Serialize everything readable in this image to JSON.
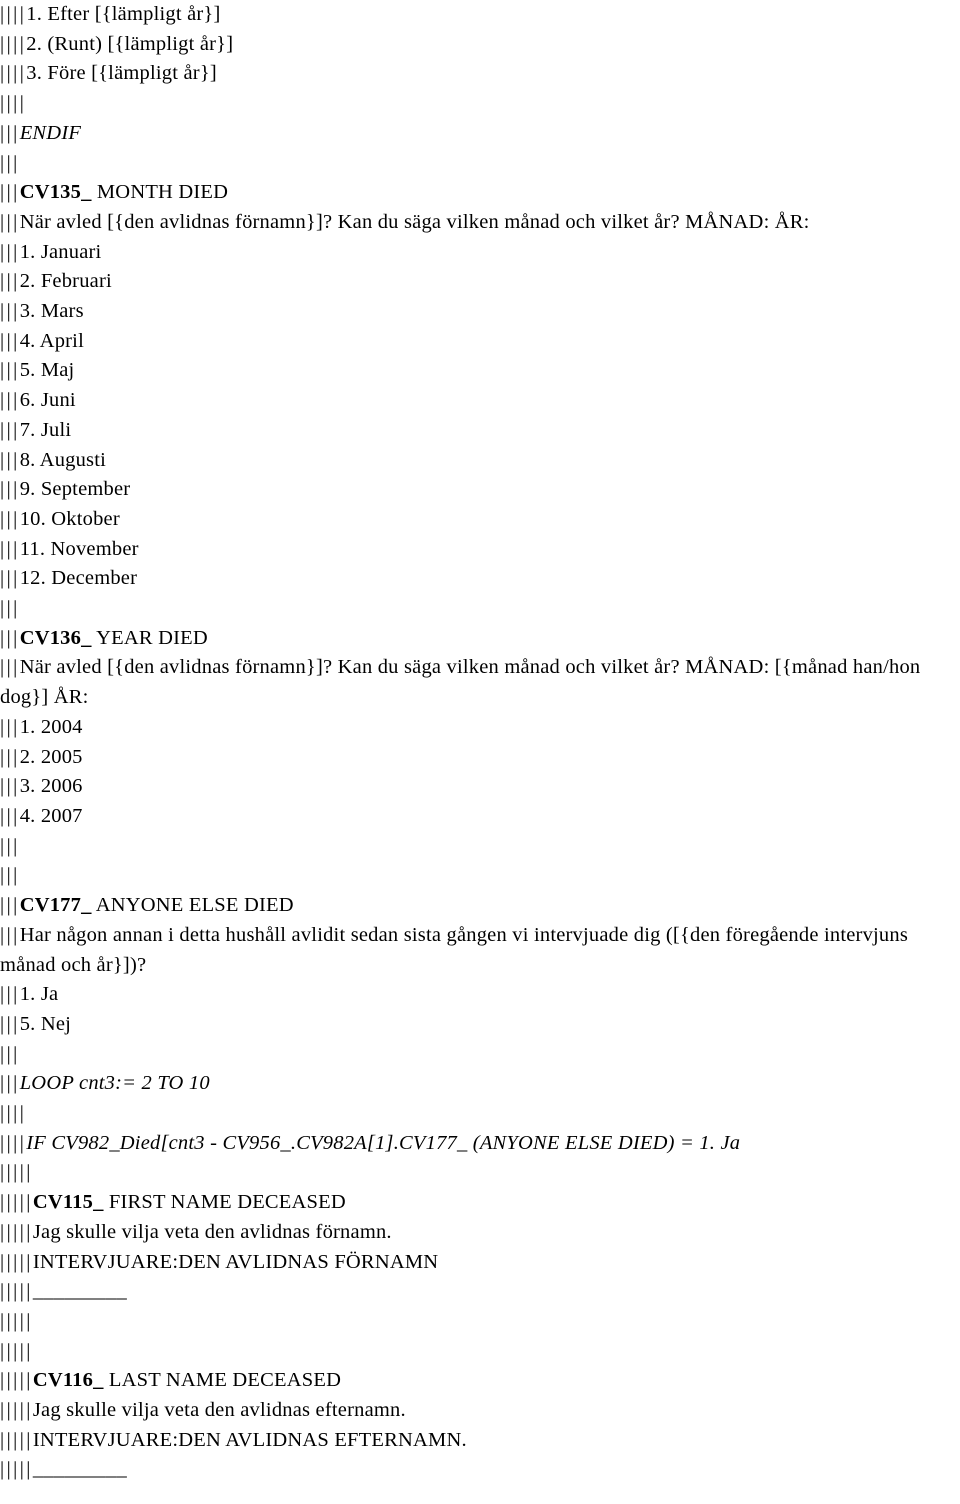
{
  "document": {
    "type": "questionnaire-specification",
    "language": "sv-SE",
    "bar_glyph": "|",
    "lines": [
      {
        "indent": 4,
        "style": "normal",
        "text": "1. Efter [{lämpligt år}]"
      },
      {
        "indent": 4,
        "style": "normal",
        "text": "2. (Runt) [{lämpligt år}]"
      },
      {
        "indent": 4,
        "style": "normal",
        "text": "3. Före [{lämpligt år}]"
      },
      {
        "indent": 4,
        "style": "normal",
        "text": ""
      },
      {
        "indent": 3,
        "style": "italic",
        "text": "ENDIF"
      },
      {
        "indent": 3,
        "style": "normal",
        "text": ""
      },
      {
        "indent": 3,
        "style": "code-head",
        "code": "CV135_",
        "text": " MONTH DIED"
      },
      {
        "indent": 3,
        "style": "normal",
        "text": "När avled [{den avlidnas förnamn}]? Kan du säga vilken månad och vilket år? MÅNAD: ÅR:"
      },
      {
        "indent": 3,
        "style": "normal",
        "text": "1. Januari"
      },
      {
        "indent": 3,
        "style": "normal",
        "text": "2. Februari"
      },
      {
        "indent": 3,
        "style": "normal",
        "text": "3. Mars"
      },
      {
        "indent": 3,
        "style": "normal",
        "text": "4. April"
      },
      {
        "indent": 3,
        "style": "normal",
        "text": "5. Maj"
      },
      {
        "indent": 3,
        "style": "normal",
        "text": "6. Juni"
      },
      {
        "indent": 3,
        "style": "normal",
        "text": "7. Juli"
      },
      {
        "indent": 3,
        "style": "normal",
        "text": "8. Augusti"
      },
      {
        "indent": 3,
        "style": "normal",
        "text": "9. September"
      },
      {
        "indent": 3,
        "style": "normal",
        "text": "10. Oktober"
      },
      {
        "indent": 3,
        "style": "normal",
        "text": "11. November"
      },
      {
        "indent": 3,
        "style": "normal",
        "text": "12. December"
      },
      {
        "indent": 3,
        "style": "normal",
        "text": ""
      },
      {
        "indent": 3,
        "style": "code-head",
        "code": "CV136_",
        "text": " YEAR DIED"
      },
      {
        "indent": 3,
        "style": "normal",
        "text": "När avled [{den avlidnas förnamn}]? Kan du säga vilken månad och vilket år? MÅNAD: [{månad han/hon dog}] ÅR:"
      },
      {
        "indent": 3,
        "style": "normal",
        "text": "1. 2004"
      },
      {
        "indent": 3,
        "style": "normal",
        "text": "2. 2005"
      },
      {
        "indent": 3,
        "style": "normal",
        "text": "3. 2006"
      },
      {
        "indent": 3,
        "style": "normal",
        "text": "4. 2007"
      },
      {
        "indent": 3,
        "style": "normal",
        "text": ""
      },
      {
        "indent": 3,
        "style": "normal",
        "text": ""
      },
      {
        "indent": 3,
        "style": "code-head",
        "code": "CV177_",
        "text": " ANYONE ELSE DIED"
      },
      {
        "indent": 3,
        "style": "normal",
        "text": "Har någon annan i detta hushåll avlidit sedan sista gången vi intervjuade dig ([{den föregående intervjuns månad och år}])?"
      },
      {
        "indent": 3,
        "style": "normal",
        "text": "1. Ja"
      },
      {
        "indent": 3,
        "style": "normal",
        "text": "5. Nej"
      },
      {
        "indent": 3,
        "style": "normal",
        "text": ""
      },
      {
        "indent": 3,
        "style": "italic",
        "text": "LOOP cnt3:= 2 TO 10"
      },
      {
        "indent": 4,
        "style": "normal",
        "text": ""
      },
      {
        "indent": 4,
        "style": "italic",
        "text": "IF CV982_Died[cnt3 - CV956_.CV982A[1].CV177_ (ANYONE ELSE DIED) = 1. Ja"
      },
      {
        "indent": 5,
        "style": "normal",
        "text": ""
      },
      {
        "indent": 5,
        "style": "code-head",
        "code": "CV115_",
        "text": " FIRST NAME DECEASED"
      },
      {
        "indent": 5,
        "style": "normal",
        "text": "Jag skulle vilja veta den avlidnas förnamn."
      },
      {
        "indent": 5,
        "style": "normal",
        "text": "INTERVJUARE:DEN AVLIDNAS FÖRNAMN"
      },
      {
        "indent": 5,
        "style": "blank-field",
        "text": "_________"
      },
      {
        "indent": 5,
        "style": "normal",
        "text": ""
      },
      {
        "indent": 5,
        "style": "normal",
        "text": ""
      },
      {
        "indent": 5,
        "style": "code-head",
        "code": "CV116_",
        "text": " LAST NAME DECEASED"
      },
      {
        "indent": 5,
        "style": "normal",
        "text": "Jag skulle vilja veta den avlidnas efternamn."
      },
      {
        "indent": 5,
        "style": "normal",
        "text": "INTERVJUARE:DEN AVLIDNAS EFTERNAMN."
      },
      {
        "indent": 5,
        "style": "blank-field",
        "text": "_________"
      }
    ]
  }
}
